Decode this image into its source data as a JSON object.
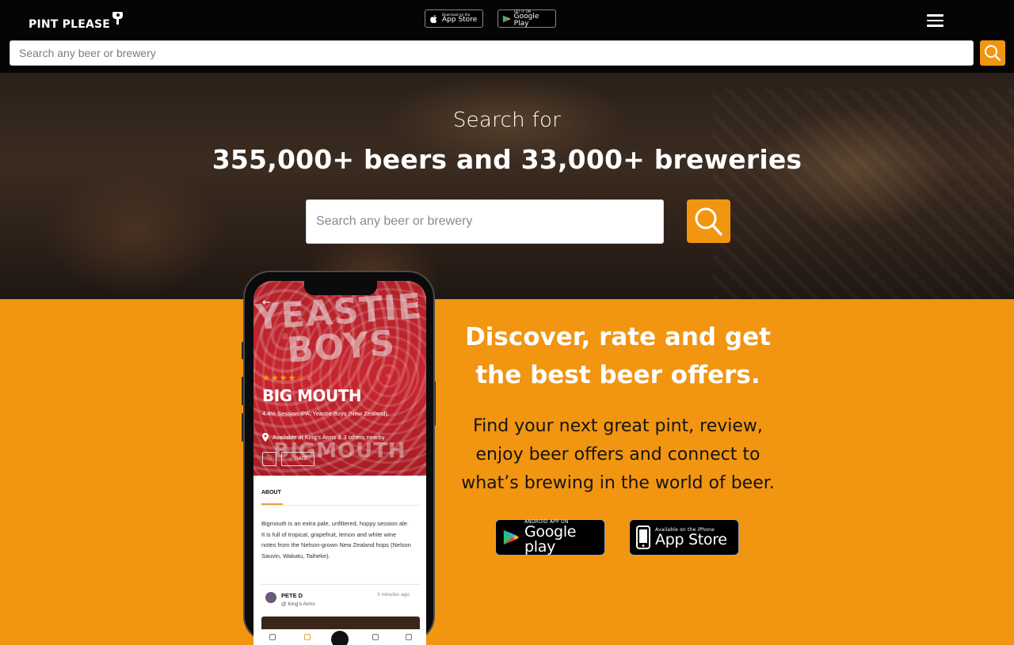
{
  "header": {
    "logo_text": "PINT PLEASE",
    "app_store_badge": {
      "small": "Download on the",
      "big": "App Store"
    },
    "google_play_badge": {
      "small": "GET IT ON",
      "big": "Google Play"
    },
    "menu_icon": "hamburger-menu-icon",
    "search": {
      "placeholder": "Search any beer or brewery",
      "button_icon": "search-icon"
    }
  },
  "hero": {
    "subtitle": "Search for",
    "title": "355,000+ beers and 33,000+ breweries",
    "search": {
      "placeholder": "Search any beer or brewery",
      "button_icon": "search-icon"
    }
  },
  "promo": {
    "title_line1": "Discover, rate and get",
    "title_line2": "the best beer offers.",
    "text_line1": "Find your next great pint, review,",
    "text_line2": "enjoy beer offers and connect to",
    "text_line3": "what’s brewing in the world of beer.",
    "google_play_button": {
      "small": "ANDROID APP ON",
      "big": "Google play"
    },
    "app_store_button": {
      "small": "Available on the iPhone",
      "big": "App Store"
    }
  },
  "phone_screen": {
    "brand_overlay_top": "YEASTIE BOYS",
    "brand_overlay_bottom": "BIGMOUTH",
    "rating": "4",
    "rating_stars": 4,
    "beer_name": "BIG MOUTH",
    "beer_meta": "4.4% Session IPA, Yeastie Boys (New Zealand),",
    "availability": "Available at King’s Arms & 3 others nearby.",
    "rate_label": "RATE",
    "about_tab": "ABOUT",
    "description": "Bigmouth is an extra pale, unfiltered, hoppy session ale. It is full of tropical, grapefruit, lemon and white wine notes from the Nelson-grown New Zealand hops (Nelson Sauvin, Wakatu, Taiheke).",
    "review_user": "PETE D",
    "review_location": "@ King’s Arms",
    "review_time": "3 minutes ago"
  },
  "colors": {
    "accent": "#f29511",
    "header_bg": "#050505",
    "beer_label_red": "#c8262f"
  }
}
